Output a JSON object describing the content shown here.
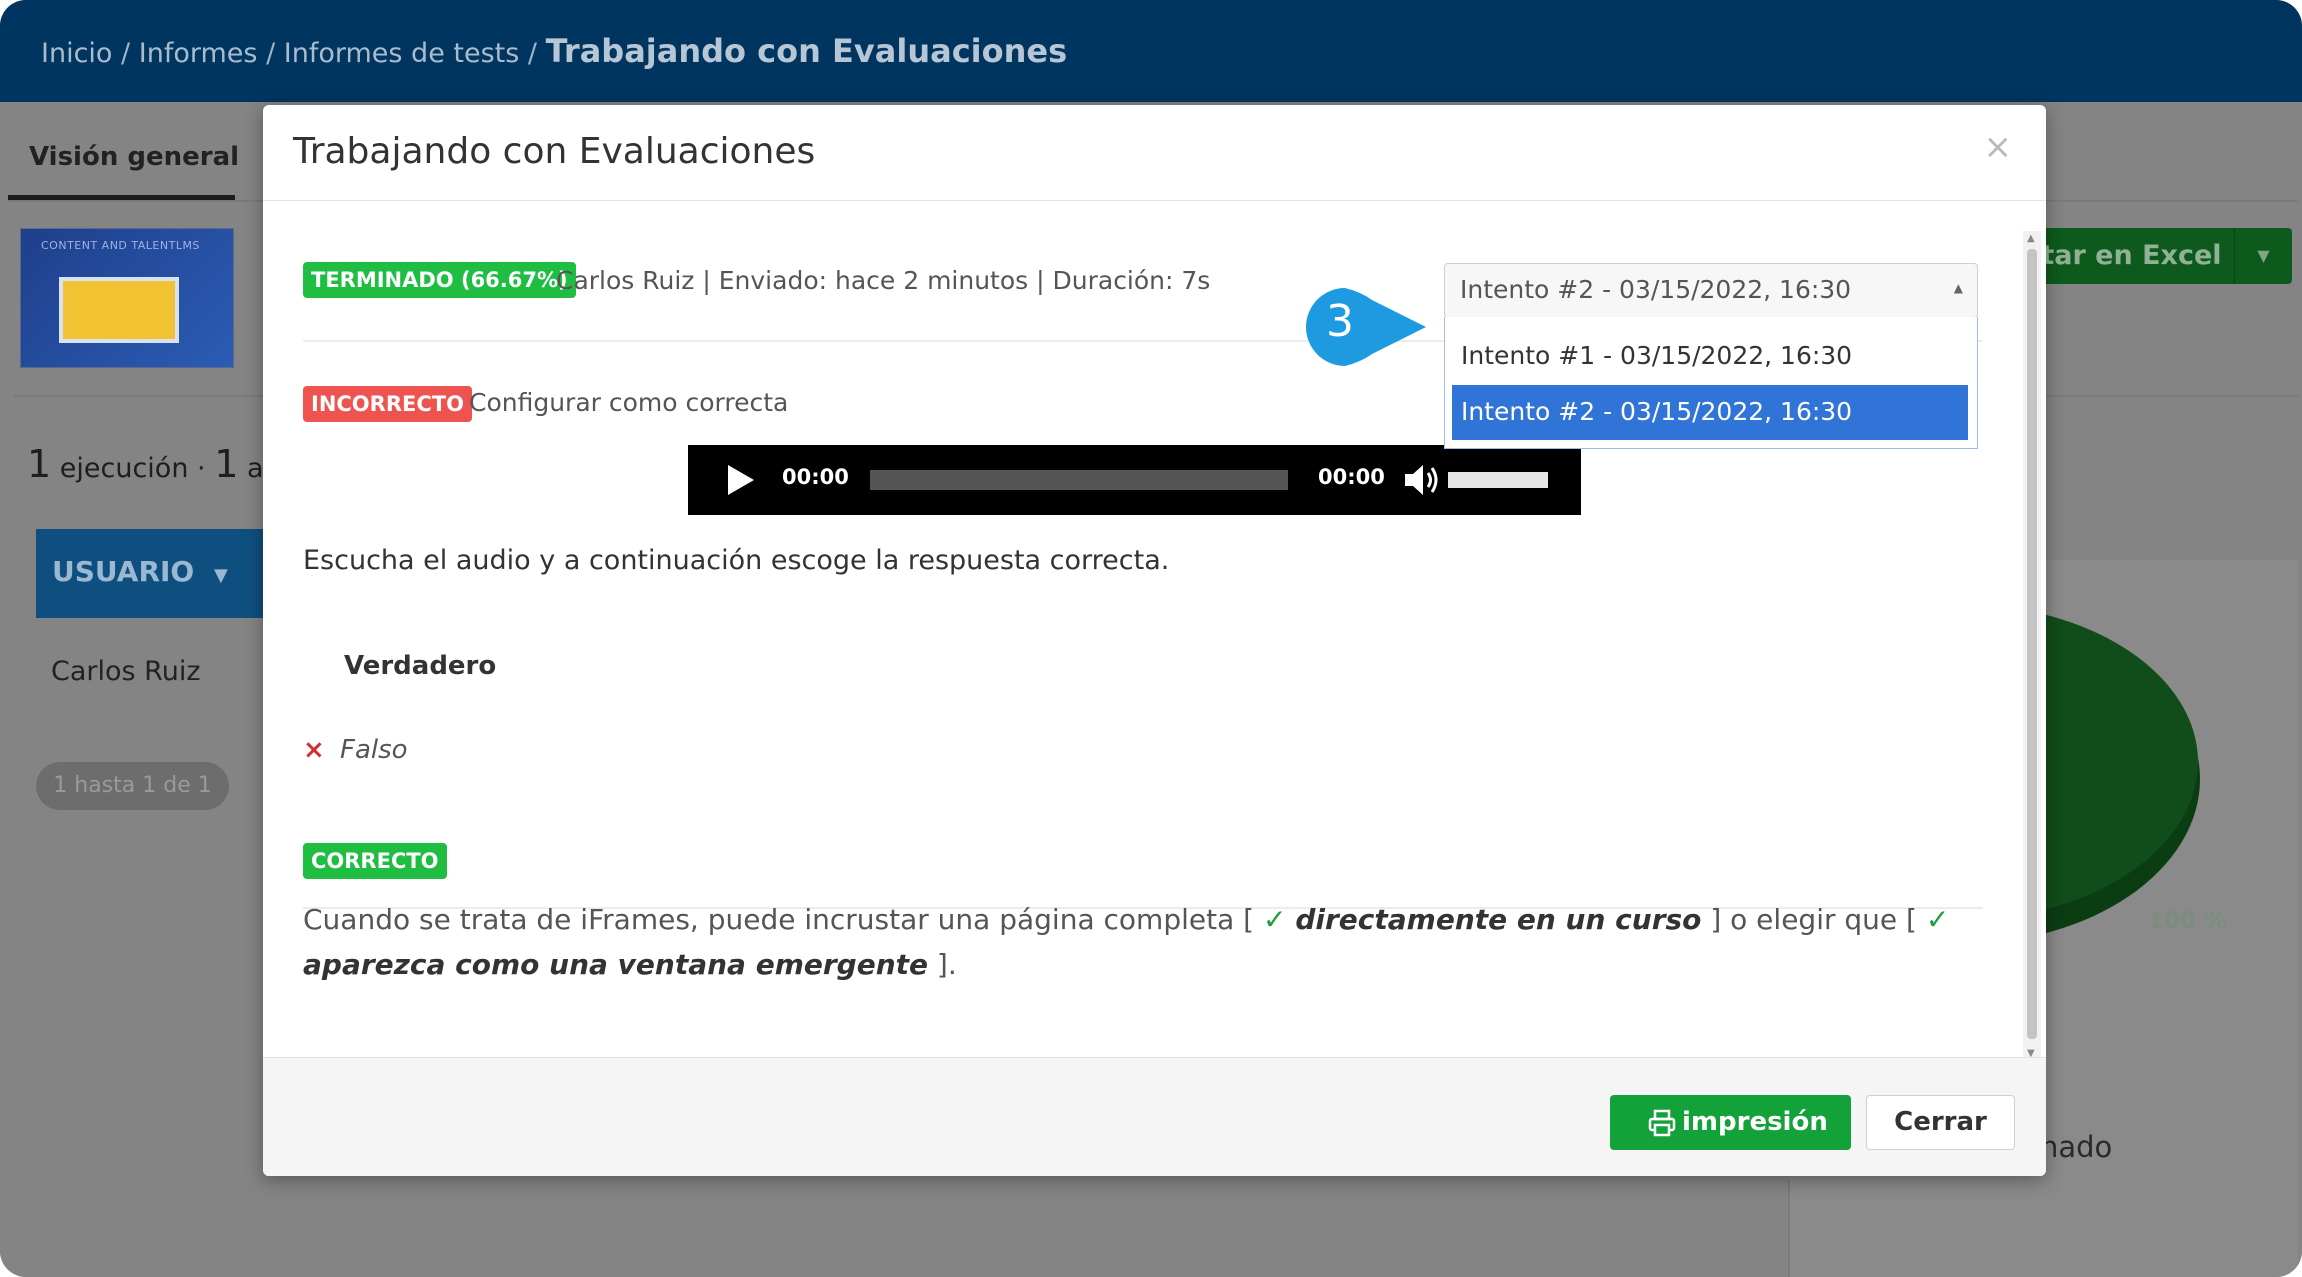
{
  "breadcrumb": {
    "items": [
      "Inicio",
      "Informes",
      "Informes de tests"
    ],
    "separator": "/",
    "current": "Trabajando con Evaluaciones"
  },
  "background": {
    "tab_overview": "Visión general",
    "thumbnail_caption": "CONTENT AND TALENTLMS",
    "executions_count": "1",
    "executions_label": "ejecución ·",
    "approved_count": "1",
    "approved_label": "apr",
    "user_column_header": "USUARIO",
    "user_row_name": "Carlos Ruiz",
    "pager_text": "1 hasta 1 de 1",
    "export_button_label": "rtar en Excel",
    "pie_percent_label": "100 %",
    "pie_color": "#114d1a",
    "legend_label_fragment": "nado"
  },
  "modal": {
    "title": "Trabajando con Evaluaciones",
    "close_symbol": "×",
    "status_badge": "TERMINADO (66.67%)",
    "meta": "Carlos Ruiz | Enviado: hace 2 minutos | Duración: 7s",
    "attempt_select": {
      "selected": "Intento #2 - 03/15/2022, 16:30",
      "options": [
        "Intento #1 - 03/15/2022, 16:30",
        "Intento #2 - 03/15/2022, 16:30"
      ],
      "highlight_color": "#3174d8"
    },
    "question1": {
      "badge": "INCORRECTO",
      "set_correct_link": "Configurar como correcta",
      "audio": {
        "current_time": "00:00",
        "total_time": "00:00"
      },
      "text": "Escucha el audio y a continuación escoge la respuesta correcta.",
      "answer_correct": "Verdadero",
      "answer_selected_wrong": "Falso",
      "wrong_symbol": "×"
    },
    "question2": {
      "badge": "CORRECTO",
      "text_1": "Cuando se trata de iFrames, puede incrustar una página completa [",
      "answer_1": "directamente en un curso",
      "text_2": "] o elegir que [",
      "answer_2": "aparezca como una ventana emergente",
      "text_3": "].",
      "check_symbol": "✓"
    },
    "footer": {
      "print_button": "impresión",
      "close_button": "Cerrar"
    }
  },
  "callout": {
    "number": "3",
    "color": "#1e9be0"
  },
  "colors": {
    "topbar": "#00355f",
    "badge_green": "#1fbe43",
    "badge_red": "#ef5350",
    "print_button": "#13a13a"
  }
}
